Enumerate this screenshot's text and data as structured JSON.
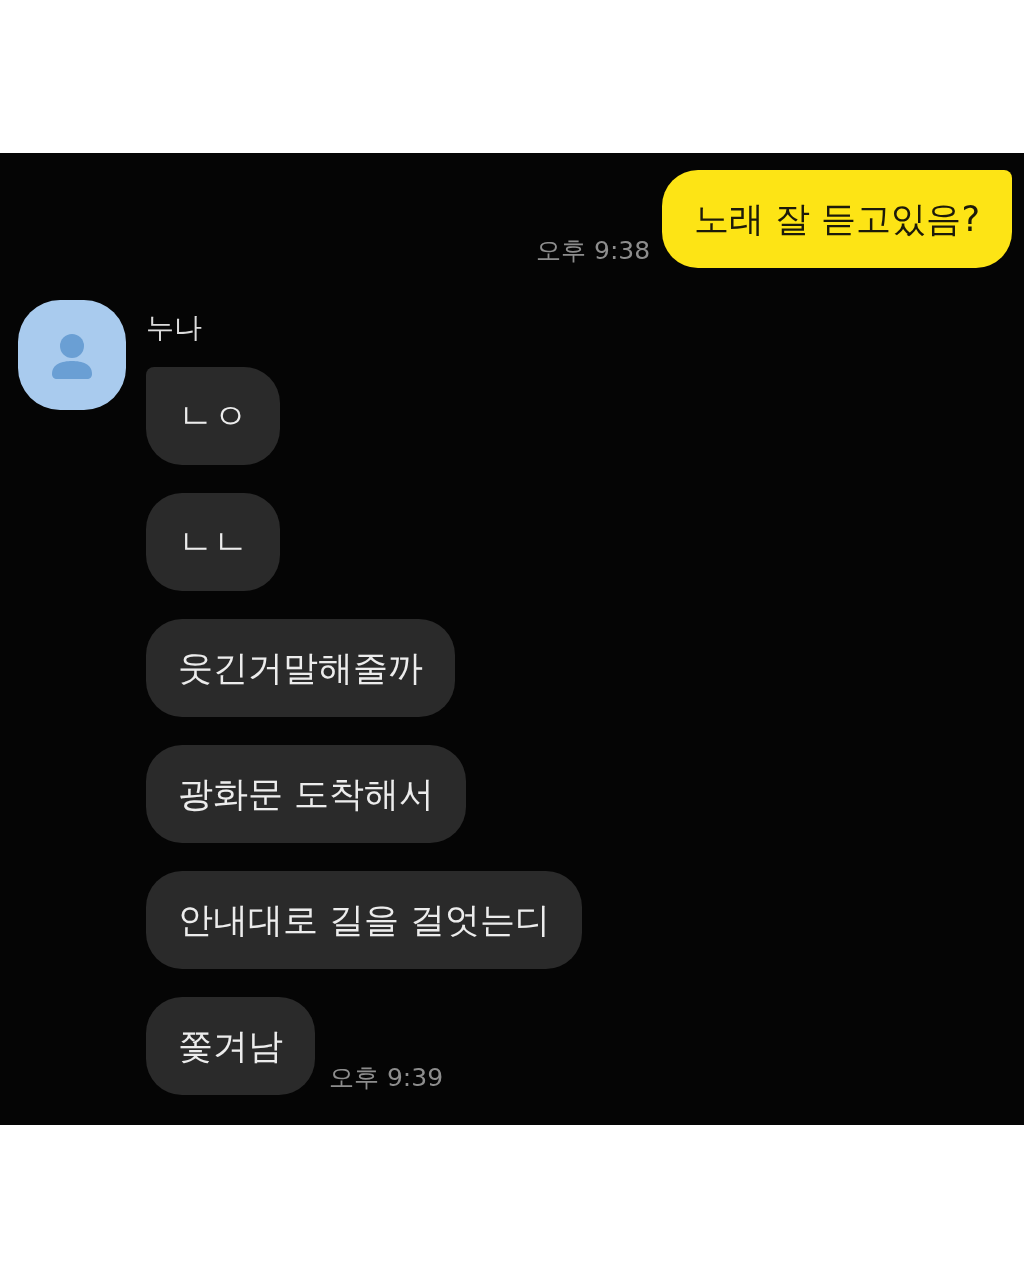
{
  "chat": {
    "sent": [
      {
        "text": "노래 잘 듣고있음?",
        "time": "오후 9:38"
      }
    ],
    "received": {
      "sender": "누나",
      "messages": [
        {
          "text": "ㄴㅇ"
        },
        {
          "text": "ㄴㄴ"
        },
        {
          "text": "웃긴거말해줄까"
        },
        {
          "text": "광화문 도착해서"
        },
        {
          "text": "안내대로 길을 걸엇는디"
        },
        {
          "text": "쫓겨남",
          "time": "오후 9:39"
        }
      ]
    }
  }
}
